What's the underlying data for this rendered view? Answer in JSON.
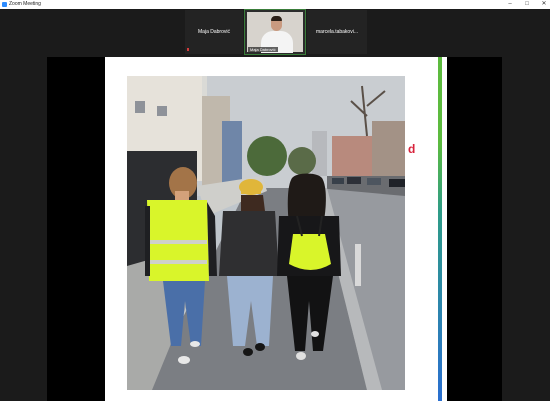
{
  "window": {
    "title": "Zoom Meeting",
    "controls": {
      "minimize": "–",
      "maximize": "□",
      "close": "✕"
    }
  },
  "participants": [
    {
      "name": "Maja Dabrović"
    },
    {
      "name": "Maja Dabrović",
      "video": true
    },
    {
      "name": "marcela.tabakovi..."
    }
  ],
  "slide": {
    "mark": "d"
  },
  "colors": {
    "accent_green": "#5dbb3f",
    "accent_blue": "#2a6fd0",
    "safety_vest": "#d9f52a"
  }
}
